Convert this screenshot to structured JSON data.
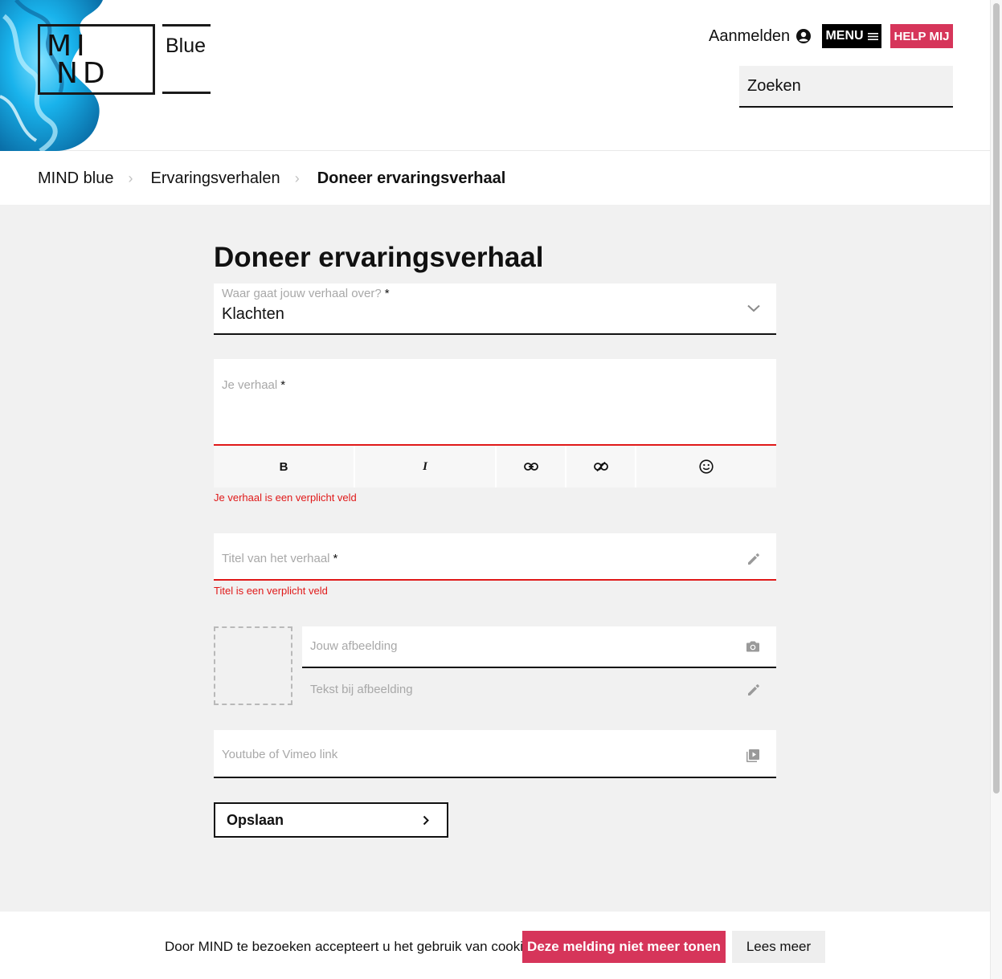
{
  "header": {
    "logo": {
      "line1": "MI",
      "line2": "ND",
      "sub": "Blue"
    },
    "login_label": "Aanmelden",
    "menu_label": "MENU",
    "help_label": "HELP MIJ",
    "search_placeholder": "Zoeken"
  },
  "breadcrumb": {
    "items": [
      "MIND blue",
      "Ervaringsverhalen"
    ],
    "current": "Doneer ervaringsverhaal"
  },
  "form": {
    "title": "Doneer ervaringsverhaal",
    "topic": {
      "label": "Waar gaat jouw verhaal over?",
      "required_mark": "*",
      "value": "Klachten"
    },
    "story": {
      "label": "Je verhaal",
      "required_mark": "*",
      "error": "Je verhaal is een verplicht veld"
    },
    "toolbar": {
      "bold": "B",
      "italic": "I"
    },
    "story_title": {
      "label": "Titel van het verhaal",
      "required_mark": "*",
      "error": "Titel is een verplicht veld"
    },
    "image": {
      "label": "Jouw afbeelding"
    },
    "caption": {
      "label": "Tekst bij afbeelding"
    },
    "video": {
      "label": "Youtube of Vimeo link"
    },
    "save_label": "Opslaan"
  },
  "cookie": {
    "text": "Door MIND te bezoeken accepteert u het gebruik van cookies",
    "accept_label": "Deze melding niet meer tonen",
    "more_label": "Lees meer"
  },
  "colors": {
    "brand_pink": "#d6355a",
    "error_red": "#e01919",
    "ink_blue": "#1ab0e6"
  }
}
